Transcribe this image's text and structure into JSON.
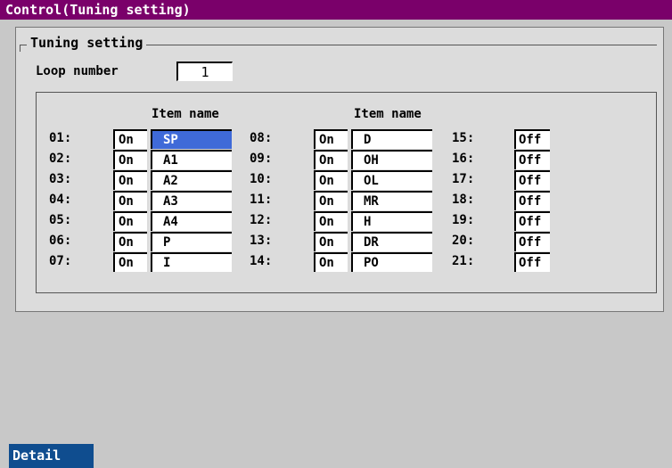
{
  "window": {
    "title": "Control(Tuning setting)"
  },
  "group": {
    "title": "Tuning setting"
  },
  "loop": {
    "label": "Loop number",
    "value": "1"
  },
  "headers": {
    "col1": "Item name",
    "col2": "Item name"
  },
  "col1": [
    {
      "num": "01:",
      "state": "On",
      "name": "SP"
    },
    {
      "num": "02:",
      "state": "On",
      "name": "A1"
    },
    {
      "num": "03:",
      "state": "On",
      "name": "A2"
    },
    {
      "num": "04:",
      "state": "On",
      "name": "A3"
    },
    {
      "num": "05:",
      "state": "On",
      "name": "A4"
    },
    {
      "num": "06:",
      "state": "On",
      "name": "P"
    },
    {
      "num": "07:",
      "state": "On",
      "name": "I"
    }
  ],
  "col2": [
    {
      "num": "08:",
      "state": "On",
      "name": "D"
    },
    {
      "num": "09:",
      "state": "On",
      "name": "OH"
    },
    {
      "num": "10:",
      "state": "On",
      "name": "OL"
    },
    {
      "num": "11:",
      "state": "On",
      "name": "MR"
    },
    {
      "num": "12:",
      "state": "On",
      "name": "H"
    },
    {
      "num": "13:",
      "state": "On",
      "name": "DR"
    },
    {
      "num": "14:",
      "state": "On",
      "name": "PO"
    }
  ],
  "col3": [
    {
      "num": "15:",
      "state": "Off"
    },
    {
      "num": "16:",
      "state": "Off"
    },
    {
      "num": "17:",
      "state": "Off"
    },
    {
      "num": "18:",
      "state": "Off"
    },
    {
      "num": "19:",
      "state": "Off"
    },
    {
      "num": "20:",
      "state": "Off"
    },
    {
      "num": "21:",
      "state": "Off"
    }
  ],
  "footer": {
    "detail_label": "Detail"
  },
  "colors": {
    "title_bar": "#7a006a",
    "selection": "#3f6ad8",
    "detail_button": "#0f4d8f"
  }
}
